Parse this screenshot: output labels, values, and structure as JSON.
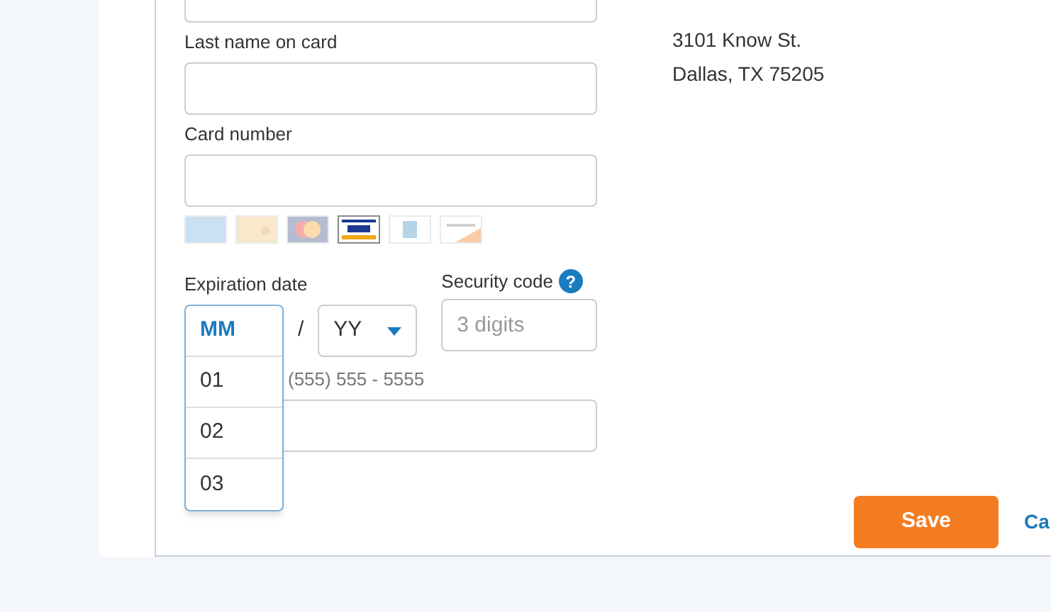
{
  "fields": [
    {
      "label": "Last name on card"
    },
    {
      "label": "Card number"
    }
  ],
  "cards": [
    {
      "kind": "blue",
      "selected": false
    },
    {
      "kind": "gold",
      "selected": false
    },
    {
      "kind": "mastercard",
      "selected": false
    },
    {
      "kind": "visa",
      "selected": true
    },
    {
      "kind": "amex",
      "selected": false
    },
    {
      "kind": "discover",
      "selected": false
    }
  ],
  "expiration": {
    "label": "Expiration date",
    "separator": "/",
    "month": {
      "value": "MM",
      "expanded": true,
      "options": [
        "01",
        "02",
        "03"
      ]
    },
    "year": {
      "value": "YY"
    }
  },
  "security": {
    "label": "Security code",
    "help": "?",
    "placeholder": "3 digits"
  },
  "phone": {
    "hint": "(555) 555 - 5555"
  },
  "address": [
    "3101 Know St.",
    "Dallas, TX 75205"
  ],
  "save": "Save",
  "cancel": "Ca"
}
